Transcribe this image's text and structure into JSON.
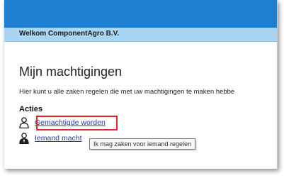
{
  "header": {
    "welcome_text": "Welkom ComponentAgro B.V."
  },
  "main": {
    "title": "Mijn machtigingen",
    "intro_text": "Hier kunt u alle zaken regelen die met uw machtigingen te maken hebbe",
    "section_title": "Acties",
    "actions": [
      {
        "label": "Gemachtigde worden",
        "icon": "person-icon"
      },
      {
        "label": "Iemand macht",
        "icon": "person-tie-icon"
      }
    ]
  },
  "tooltip": {
    "text": "Ik mag zaken voor iemand regelen"
  },
  "colors": {
    "top_bar": "#1e7fd2",
    "welcome_bar": "#a9d4f2",
    "link": "#1f3f9b",
    "highlight": "#e0262b"
  }
}
